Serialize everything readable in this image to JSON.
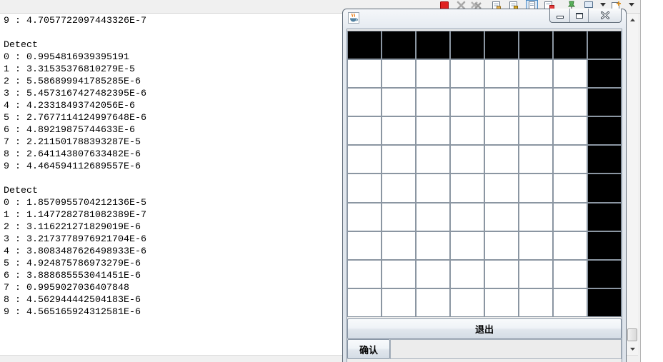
{
  "console": {
    "lines": [
      "9 : 4.7057722097443326E-7",
      "",
      "Detect",
      "0 : 0.9954816939395191",
      "1 : 3.31535376810279E-5",
      "2 : 5.586899941785285E-6",
      "3 : 5.4573167427482395E-6",
      "4 : 4.23318493742056E-6",
      "5 : 2.7677114124997648E-6",
      "6 : 4.89219875744633E-6",
      "7 : 2.211501788393287E-5",
      "8 : 2.641143807633482E-6",
      "9 : 4.464594112689557E-6",
      "",
      "Detect",
      "0 : 1.8570955704212136E-5",
      "1 : 1.1477282781082389E-7",
      "2 : 3.116221271829019E-6",
      "3 : 3.2173778976921704E-6",
      "4 : 3.8083487626498933E-6",
      "5 : 4.924875786973279E-6",
      "6 : 3.888685553041451E-6",
      "7 : 0.9959027036407848",
      "8 : 4.562944442504183E-6",
      "9 : 4.565165924312581E-6"
    ]
  },
  "console_toolbar": {
    "icons": [
      "terminate-icon",
      "remove-launch-icon",
      "remove-all-terminated-icon",
      "clear-console-icon",
      "scroll-lock-icon",
      "show-console-on-output-icon",
      "show-console-on-error-icon",
      "pin-console-icon",
      "display-selected-console-icon",
      "chevron-down-icon",
      "open-console-icon",
      "chevron-down-icon"
    ]
  },
  "window": {
    "titlebar_icon": "java-icon",
    "controls": [
      "minimize-icon",
      "maximize-icon",
      "close-icon"
    ],
    "grid": {
      "cells": [
        [
          1,
          1,
          1,
          1,
          1,
          1,
          1,
          1
        ],
        [
          0,
          0,
          0,
          0,
          0,
          0,
          0,
          1
        ],
        [
          0,
          0,
          0,
          0,
          0,
          0,
          0,
          1
        ],
        [
          0,
          0,
          0,
          0,
          0,
          0,
          0,
          1
        ],
        [
          0,
          0,
          0,
          0,
          0,
          0,
          0,
          1
        ],
        [
          0,
          0,
          0,
          0,
          0,
          0,
          0,
          1
        ],
        [
          0,
          0,
          0,
          0,
          0,
          0,
          0,
          1
        ],
        [
          0,
          0,
          0,
          0,
          0,
          0,
          0,
          1
        ],
        [
          0,
          0,
          0,
          0,
          0,
          0,
          0,
          1
        ],
        [
          0,
          0,
          0,
          0,
          0,
          0,
          0,
          1
        ]
      ]
    },
    "exit_button": "退出",
    "confirm_button": "确认",
    "input_value": ""
  },
  "colors": {
    "filled_cell": "#000000",
    "empty_cell": "#ffffff"
  }
}
